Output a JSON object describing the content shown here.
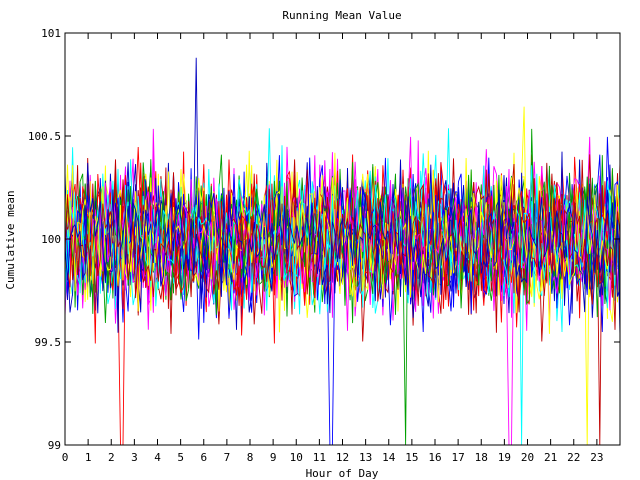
{
  "chart_data": {
    "type": "line",
    "title": "Running Mean Value",
    "xlabel": "Hour of Day",
    "ylabel": "Cumulative mean",
    "xlim": [
      0,
      24
    ],
    "ylim": [
      99,
      101
    ],
    "x_ticks": [
      "0",
      "1",
      "2",
      "3",
      "4",
      "5",
      "6",
      "7",
      "8",
      "9",
      "10",
      "11",
      "12",
      "13",
      "14",
      "15",
      "16",
      "17",
      "18",
      "19",
      "20",
      "21",
      "22",
      "23"
    ],
    "y_ticks": [
      "99",
      "99.5",
      "100",
      "100.5",
      "101"
    ],
    "series_count": 40,
    "samples_per_series": 220,
    "center": 100,
    "typical_spread": 0.15,
    "grid": false,
    "legend": "none",
    "series_colors": [
      "#ff0000",
      "#0000ff",
      "#00a000",
      "#ff00ff",
      "#00ffff",
      "#ffff00",
      "#c00000",
      "#0000c0"
    ],
    "spikes": [
      {
        "x": 2.45,
        "y": 99.0
      },
      {
        "x": 11.5,
        "y": 99.0
      },
      {
        "x": 14.75,
        "y": 99.0
      },
      {
        "x": 19.25,
        "y": 99.0
      },
      {
        "x": 19.75,
        "y": 99.0
      },
      {
        "x": 22.6,
        "y": 99.0
      },
      {
        "x": 23.1,
        "y": 99.0
      },
      {
        "x": 5.7,
        "y": 100.88
      }
    ]
  }
}
